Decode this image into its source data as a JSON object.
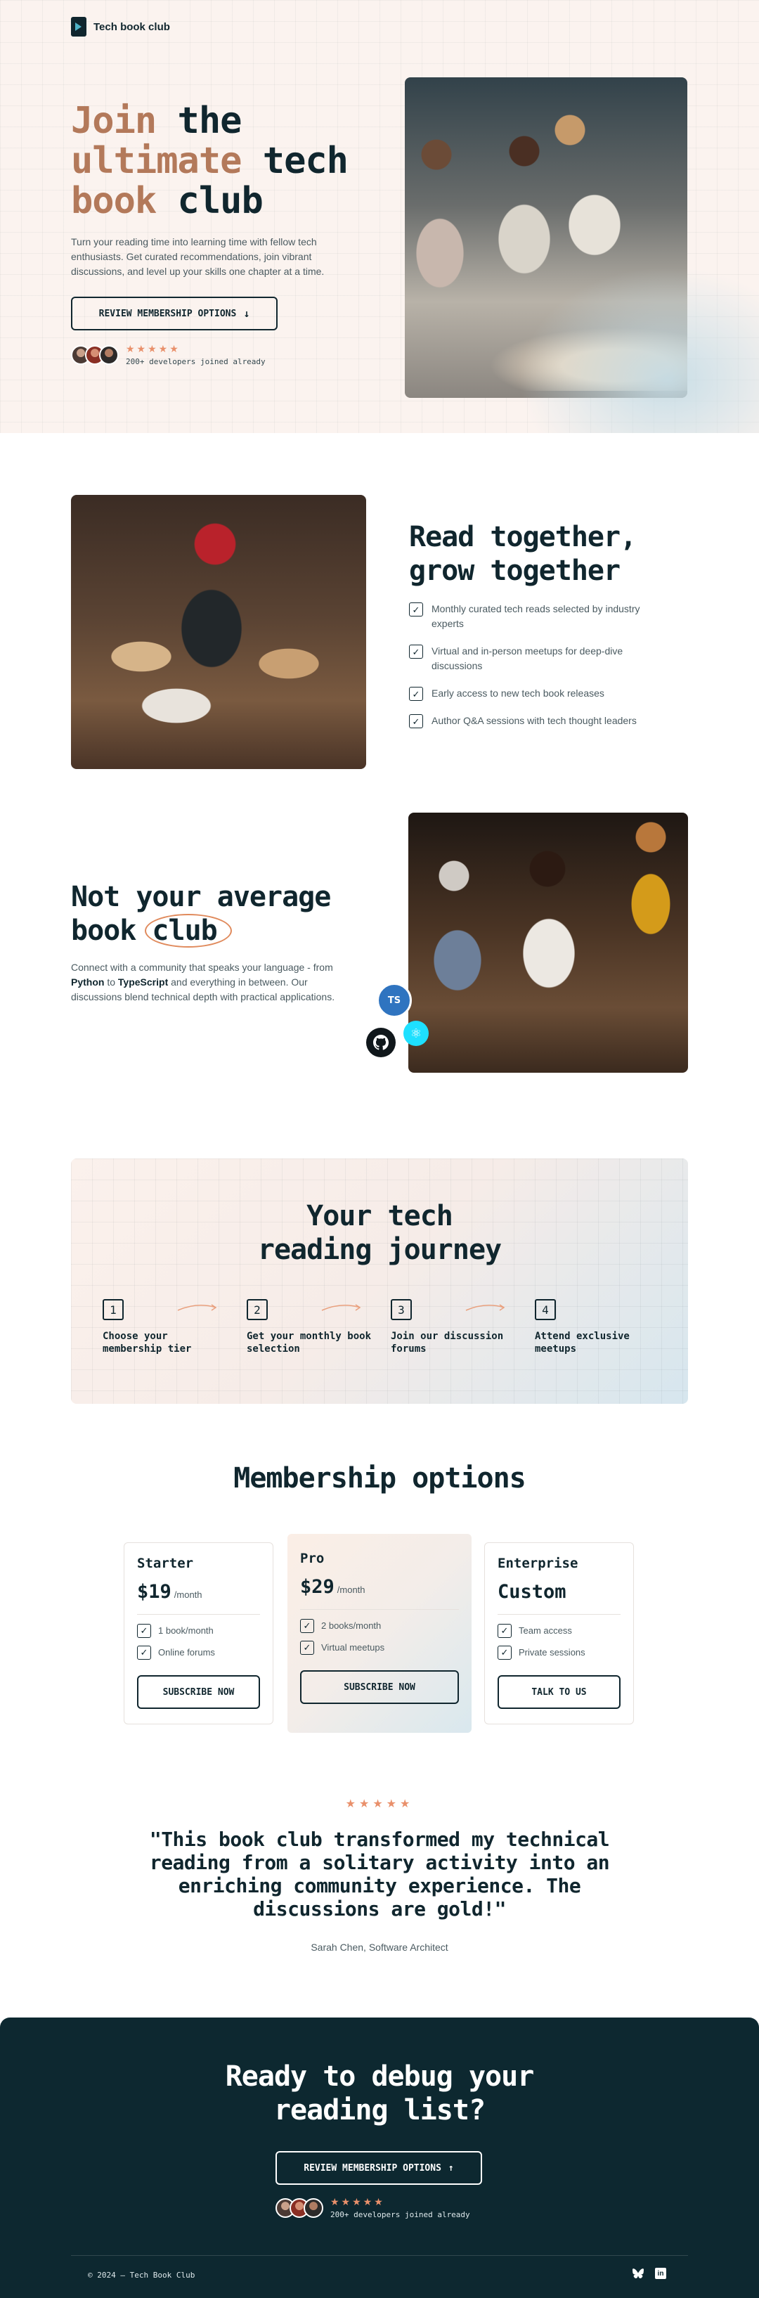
{
  "brand": {
    "name": "Tech book club"
  },
  "hero": {
    "title_accent": "Join",
    "title_rest_1": "the",
    "title_accent_2": "ultimate",
    "title_rest_2": "tech",
    "title_accent_3": "book",
    "title_rest_3": "club",
    "subtitle": "Turn your reading time into learning time with fellow tech enthusiasts. Get curated recommendations, join vibrant discussions, and level up your skills one chapter at a time.",
    "cta_label": "REVIEW MEMBERSHIP OPTIONS",
    "cta_icon": "↓",
    "stars": "★★★★★",
    "social_proof": "200+ developers joined already"
  },
  "read_together": {
    "title_line_1": "Read together,",
    "title_line_2": "grow together",
    "features": [
      "Monthly curated tech reads selected by industry experts",
      "Virtual and in-person meetups for deep-dive discussions",
      "Early access to new tech book releases",
      "Author Q&A sessions with tech thought leaders"
    ]
  },
  "not_average": {
    "title_line_1": "Not your average",
    "title_word_book": "book",
    "title_word_club": "club",
    "sub_part_1": "Connect with a community that speaks your language - from ",
    "sub_bold_1": "Python",
    "sub_part_2": " to ",
    "sub_bold_2": "TypeScript",
    "sub_part_3": " and everything in between. Our discussions blend technical depth with practical applications.",
    "badges": {
      "typescript": "TS",
      "react": "⚛",
      "github": ""
    }
  },
  "journey": {
    "title_line_1": "Your tech",
    "title_line_2": "reading journey",
    "steps": [
      {
        "num": "1",
        "label": "Choose your membership tier"
      },
      {
        "num": "2",
        "label": "Get your monthly book selection"
      },
      {
        "num": "3",
        "label": "Join our discussion forums"
      },
      {
        "num": "4",
        "label": "Attend exclusive meetups"
      }
    ]
  },
  "membership": {
    "title": "Membership options",
    "plans": [
      {
        "name": "Starter",
        "price": "$19",
        "per": "/month",
        "features": [
          "1 book/month",
          "Online forums"
        ],
        "cta": "SUBSCRIBE NOW"
      },
      {
        "name": "Pro",
        "price": "$29",
        "per": "/month",
        "features": [
          "2 books/month",
          "Virtual meetups"
        ],
        "cta": "SUBSCRIBE NOW"
      },
      {
        "name": "Enterprise",
        "price": "Custom",
        "per": "",
        "features": [
          "Team access",
          "Private sessions"
        ],
        "cta": "TALK TO US"
      }
    ]
  },
  "testimonial": {
    "stars": "★★★★★",
    "quote": "\"This book club transformed my technical reading from a solitary activity into an enriching community experience. The discussions are gold!\"",
    "author": "Sarah Chen, Software Architect"
  },
  "footer": {
    "title_line_1": "Ready to debug your",
    "title_line_2": "reading list?",
    "cta_label": "REVIEW MEMBERSHIP OPTIONS",
    "cta_icon": "↑",
    "stars": "★★★★★",
    "social_proof": "200+ developers joined already",
    "copyright": "© 2024 — Tech Book Club",
    "icons": [
      "butterfly-icon",
      "linkedin-icon"
    ]
  },
  "colors": {
    "accent": "#b3795a",
    "dark": "#10262e",
    "star": "#e9906b",
    "footer_bg": "#0d2830"
  }
}
